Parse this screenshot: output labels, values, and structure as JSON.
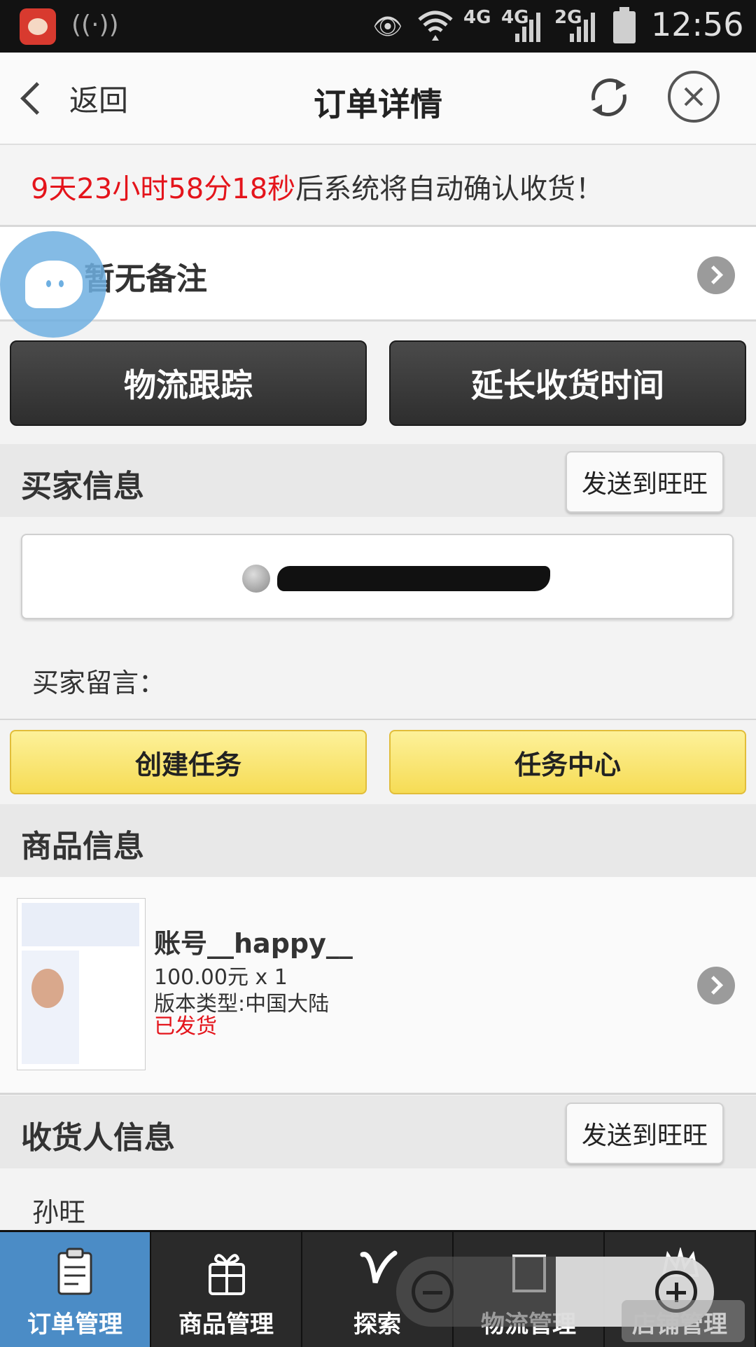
{
  "status_bar": {
    "network_1": "4G",
    "network_2": "4G",
    "network_3": "2G",
    "time": "12:56"
  },
  "header": {
    "back_label": "返回",
    "title": "订单详情"
  },
  "countdown": {
    "remaining": "9天23小时58分18秒",
    "text": "后系统将自动确认收货！"
  },
  "remark": {
    "text": "暂无备注"
  },
  "actions": {
    "logistics": "物流跟踪",
    "extend": "延长收货时间"
  },
  "buyer": {
    "heading": "买家信息",
    "send_button": "发送到旺旺",
    "message_label": "买家留言："
  },
  "tasks": {
    "create": "创建任务",
    "center": "任务中心"
  },
  "goods": {
    "heading": "商品信息",
    "title": "账号__happy__",
    "price": "100.00元 x 1",
    "version": "版本类型:中国大陆",
    "status": "已发货",
    "status_color": "#e4141b"
  },
  "consignee": {
    "heading": "收货人信息",
    "send_button": "发送到旺旺",
    "name": "孙旺"
  },
  "tabbar": [
    {
      "label": "订单管理",
      "icon": "clipboard-icon",
      "active": true
    },
    {
      "label": "商品管理",
      "icon": "gift-icon"
    },
    {
      "label": "探索",
      "icon": "v-logo-icon"
    },
    {
      "label": "物流管理",
      "icon": "box-icon"
    },
    {
      "label": "店铺管理",
      "icon": "crown-icon"
    }
  ]
}
